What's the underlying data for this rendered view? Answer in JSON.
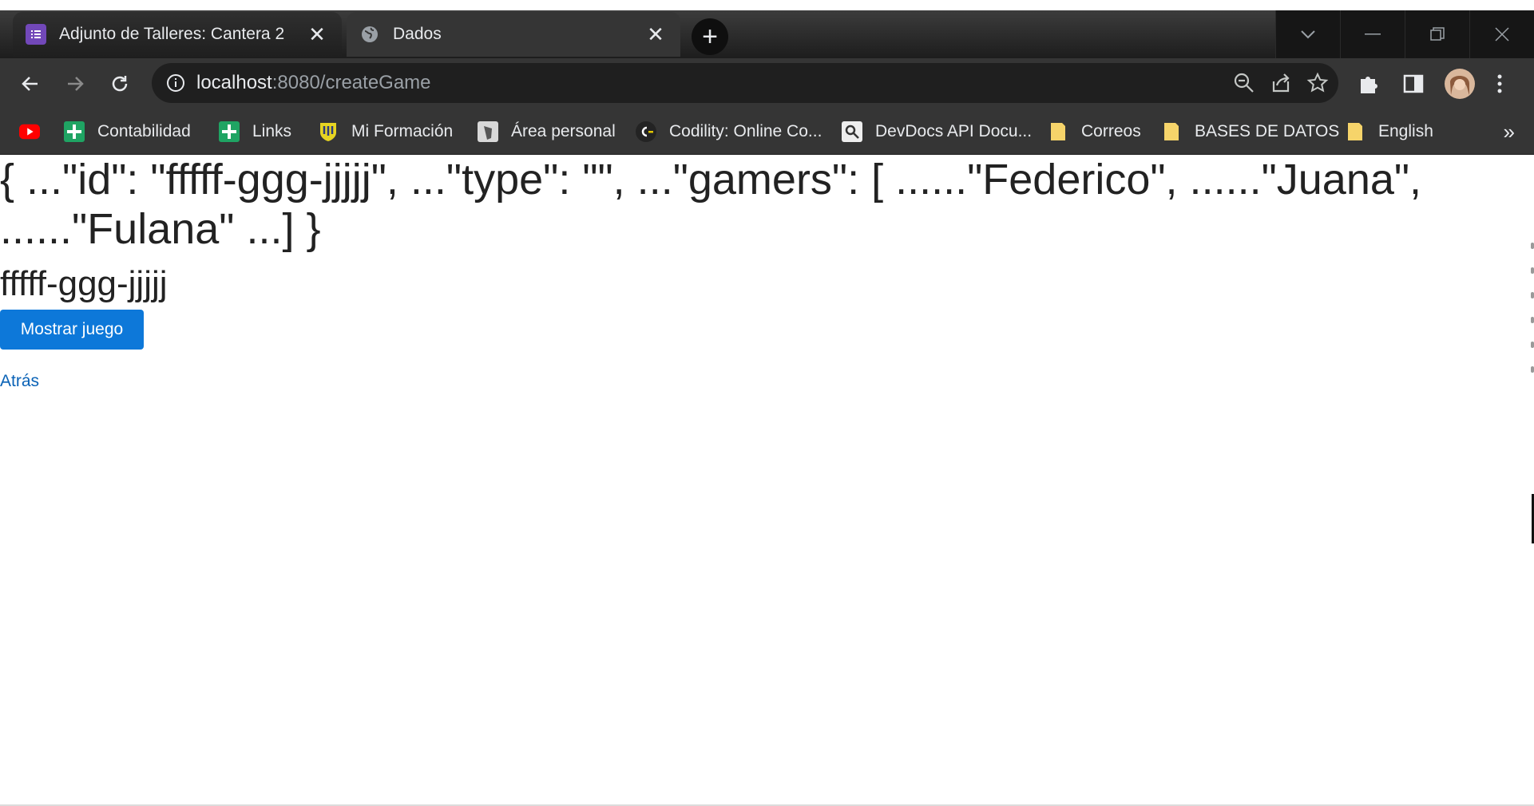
{
  "browser": {
    "tabs": [
      {
        "title": "Adjunto de Talleres: Cantera 2",
        "icon": "forms-icon",
        "color": "#7248b9"
      },
      {
        "title": "Dados",
        "icon": "globe-icon"
      }
    ],
    "address": {
      "host": "localhost",
      "path": ":8080/createGame"
    },
    "bookmarks": [
      {
        "label": "",
        "icon": "youtube-icon"
      },
      {
        "label": "Contabilidad",
        "icon": "sheets-icon"
      },
      {
        "label": "Links",
        "icon": "sheets-icon"
      },
      {
        "label": "Mi Formación",
        "icon": "crest-icon"
      },
      {
        "label": "Área personal",
        "icon": "moodle-icon"
      },
      {
        "label": "Codility: Online Co...",
        "icon": "codility-icon"
      },
      {
        "label": "DevDocs API Docu...",
        "icon": "devdocs-icon"
      },
      {
        "label": "Correos",
        "icon": "folder-icon"
      },
      {
        "label": "BASES DE DATOS",
        "icon": "folder-icon"
      },
      {
        "label": "English",
        "icon": "folder-icon"
      }
    ],
    "more_bookmarks": "»"
  },
  "page": {
    "json_text": "{ ...\"id\": \"fffff-ggg-jjjjj\", ...\"type\": \"\", ...\"gamers\": [ ......\"Federico\", ......\"Juana\", ......\"Fulana\" ...] }",
    "game_id": "fffff-ggg-jjjjj",
    "show_button": "Mostrar juego",
    "back_link": "Atrás"
  },
  "colors": {
    "primary_button": "#0d78d9",
    "link": "#0a62b6"
  }
}
